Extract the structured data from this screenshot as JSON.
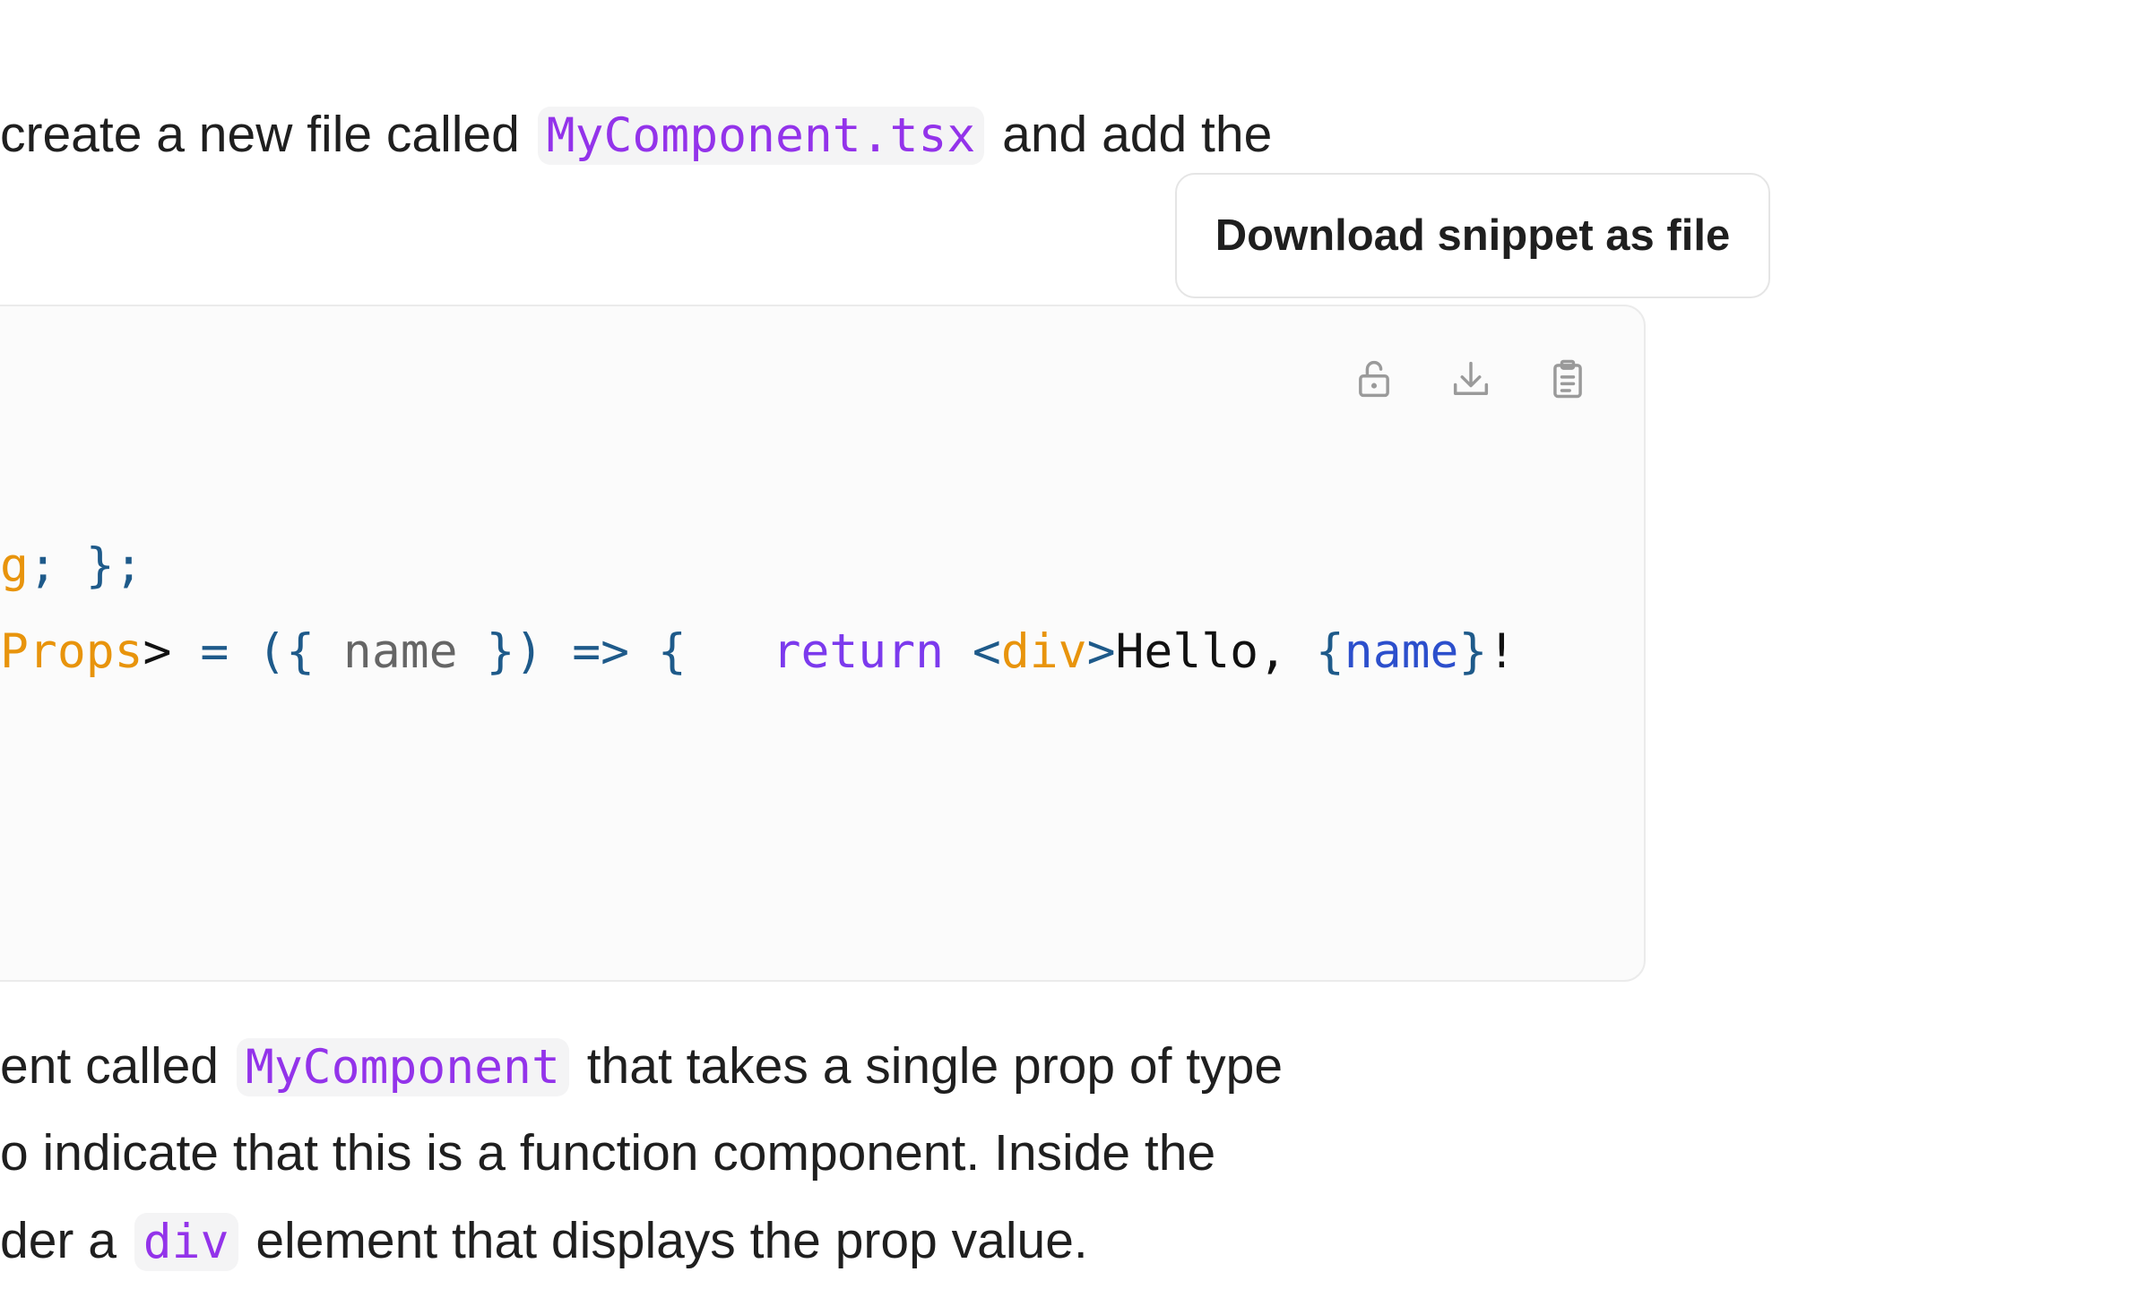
{
  "intro": {
    "text_before": "create a new file called",
    "filename": "MyComponent.tsx",
    "text_after": "and add the"
  },
  "tooltip": {
    "label": "Download snippet as file"
  },
  "toolbar": {
    "icons": [
      "unlock-icon",
      "download-icon",
      "clipboard-icon"
    ]
  },
  "code": {
    "line1": {
      "type_end": "g",
      "rest": "; };"
    },
    "line2": {
      "type": "Props",
      "gt": ">",
      "arrow_open": " = ({",
      "param": " name ",
      "arrow_close": "}) => {   ",
      "kw": "return",
      "tag_open": " <",
      "tag": "div",
      "tag_close": ">",
      "text": "Hello, ",
      "brace_open": "{",
      "var": "name",
      "brace_close": "}",
      "excl": "!"
    }
  },
  "explanation": {
    "line1_before": "ent called",
    "line1_code": "MyComponent",
    "line1_after": "that takes a single prop of type",
    "line2": "o indicate that this is a function component. Inside the",
    "line3_before": "der a",
    "line3_code": "div",
    "line3_after": "element that displays the prop value."
  },
  "colors": {
    "inline_code": "#9333ea",
    "code_punctuation": "#1e5a8a",
    "code_type": "#e8940c",
    "code_keyword": "#7c3aed",
    "code_variable": "#2c4fcc",
    "icon_gray": "#9a9a9a"
  }
}
